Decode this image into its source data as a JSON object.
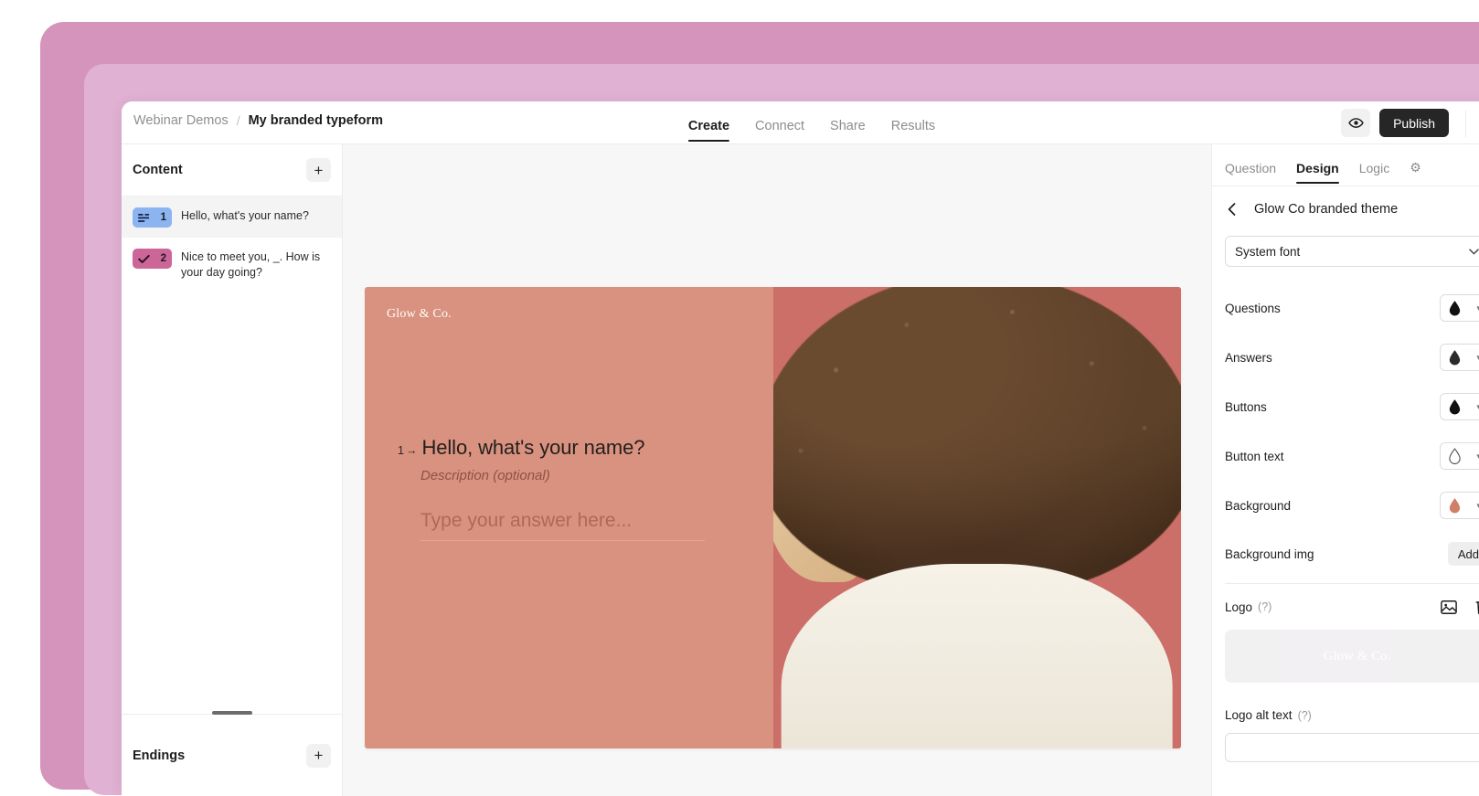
{
  "app": {
    "breadcrumb": {
      "workspace": "Webinar Demos",
      "separator": "/",
      "current": "My branded typeform"
    },
    "tabs": [
      {
        "label": "Create",
        "active": true
      },
      {
        "label": "Connect",
        "active": false
      },
      {
        "label": "Share",
        "active": false
      },
      {
        "label": "Results",
        "active": false
      }
    ],
    "top_right": {
      "preview_icon": "eye-icon",
      "publish_label": "Publish",
      "avatar": "user-avatar"
    }
  },
  "sidebar": {
    "title": "Content",
    "add_label": "+",
    "questions": [
      {
        "number": "1",
        "type_icon": "short-text-icon",
        "badge_color": "#8cb4f0",
        "text": "Hello, what's your name?",
        "selected": true
      },
      {
        "number": "2",
        "type_icon": "checkmark-icon",
        "badge_color": "#cc6699",
        "text": "Nice to meet you, _. How is your day going?",
        "selected": false
      }
    ],
    "endings": {
      "title": "Endings",
      "add_label": "+"
    }
  },
  "form_preview": {
    "logo_text": "Glow & Co.",
    "question_number": "1",
    "arrow": "→",
    "question_title": "Hello, what's your name?",
    "description_placeholder": "Description (optional)",
    "answer_placeholder": "Type your answer here...",
    "background_color": "#d9927f",
    "image_alt": "Portrait of a smiling woman with curly dark hair"
  },
  "design_panel": {
    "tabs": [
      {
        "label": "Question",
        "active": false
      },
      {
        "label": "Design",
        "active": true
      },
      {
        "label": "Logic",
        "active": false
      },
      {
        "label": "⚙",
        "active": false
      }
    ],
    "back_icon": "chevron-left-icon",
    "theme_name": "Glow Co branded theme",
    "font": {
      "value": "System font",
      "chevron": "chevron-down-icon"
    },
    "color_rows": [
      {
        "label": "Questions",
        "icon": "droplet-icon",
        "color": "#111111",
        "filled": true
      },
      {
        "label": "Answers",
        "icon": "droplet-icon",
        "color": "#2b2b2b",
        "filled": true
      },
      {
        "label": "Buttons",
        "icon": "droplet-icon",
        "color": "#111111",
        "filled": true
      },
      {
        "label": "Button text",
        "icon": "droplet-icon",
        "color": "#ffffff",
        "filled": false
      },
      {
        "label": "Background",
        "icon": "droplet-icon",
        "color": "#d08068",
        "filled": true
      }
    ],
    "background_img": {
      "label": "Background img",
      "add_label": "Add"
    },
    "logo": {
      "label": "Logo",
      "help": "(?)",
      "image_icon": "image-icon",
      "delete_icon": "trash-icon",
      "preview_text": "Glow & Co."
    },
    "logo_alt": {
      "label": "Logo alt text",
      "help": "(?)",
      "value": ""
    }
  }
}
